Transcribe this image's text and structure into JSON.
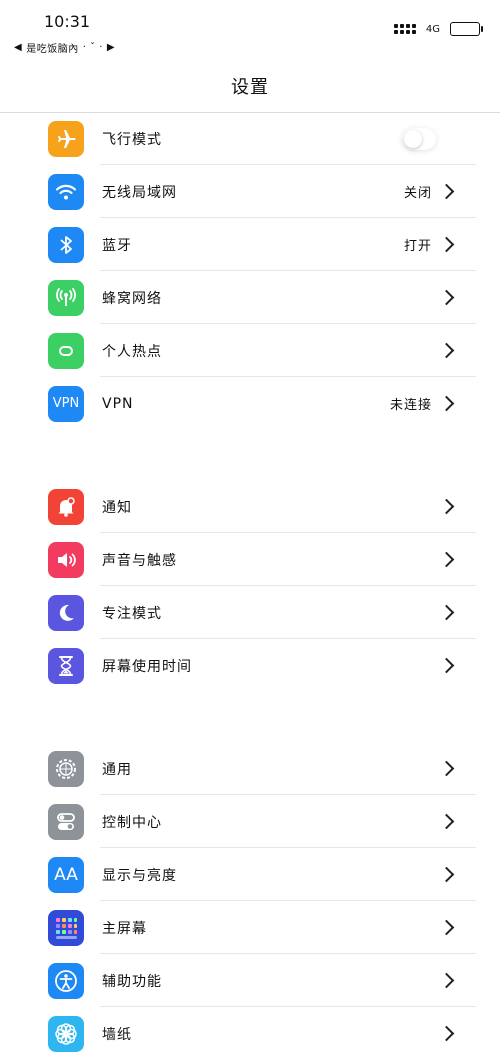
{
  "status": {
    "time": "10:31",
    "back_label": "是吃饭脑內",
    "network": "4G"
  },
  "nav": {
    "title": "设置"
  },
  "groups": [
    {
      "rows": [
        {
          "label": "飞行模式",
          "value": "",
          "type": "toggle",
          "icon": "airplane-icon",
          "color": "#f7a21b"
        },
        {
          "label": "无线局域网",
          "value": "关闭",
          "type": "link",
          "icon": "wifi-icon",
          "color": "#1e88f5"
        },
        {
          "label": "蓝牙",
          "value": "打开",
          "type": "link",
          "icon": "bluetooth-icon",
          "color": "#1e88f5"
        },
        {
          "label": "蜂窝网络",
          "value": "",
          "type": "link",
          "icon": "cellular-icon",
          "color": "#3cd064"
        },
        {
          "label": "个人热点",
          "value": "",
          "type": "link",
          "icon": "hotspot-icon",
          "color": "#3cd064"
        },
        {
          "label": "VPN",
          "value": "未连接",
          "type": "link",
          "icon": "vpn-icon",
          "icon_text": "VPN",
          "color": "#1e88f5"
        }
      ]
    },
    {
      "rows": [
        {
          "label": "通知",
          "value": "",
          "type": "link",
          "icon": "notification-icon",
          "color": "#f24436"
        },
        {
          "label": "声音与触感",
          "value": "",
          "type": "link",
          "icon": "speaker-icon",
          "color": "#f23b5e"
        },
        {
          "label": "专注模式",
          "value": "",
          "type": "link",
          "icon": "moon-icon",
          "color": "#5a56e0"
        },
        {
          "label": "屏幕使用时间",
          "value": "",
          "type": "link",
          "icon": "hourglass-icon",
          "color": "#5a56e0"
        }
      ]
    },
    {
      "rows": [
        {
          "label": "通用",
          "value": "",
          "type": "link",
          "icon": "gear-icon",
          "color": "#8e9399"
        },
        {
          "label": "控制中心",
          "value": "",
          "type": "link",
          "icon": "switches-icon",
          "color": "#8e9399"
        },
        {
          "label": "显示与亮度",
          "value": "",
          "type": "link",
          "icon": "text-size-icon",
          "icon_text": "AA",
          "color": "#1e88f5"
        },
        {
          "label": "主屏幕",
          "value": "",
          "type": "link",
          "icon": "home-screen-icon",
          "color": "#2f4bd8"
        },
        {
          "label": "辅助功能",
          "value": "",
          "type": "link",
          "icon": "accessibility-icon",
          "color": "#1e88f5"
        },
        {
          "label": "墙纸",
          "value": "",
          "type": "link",
          "icon": "wallpaper-icon",
          "color": "#2fb6f0"
        }
      ]
    }
  ]
}
